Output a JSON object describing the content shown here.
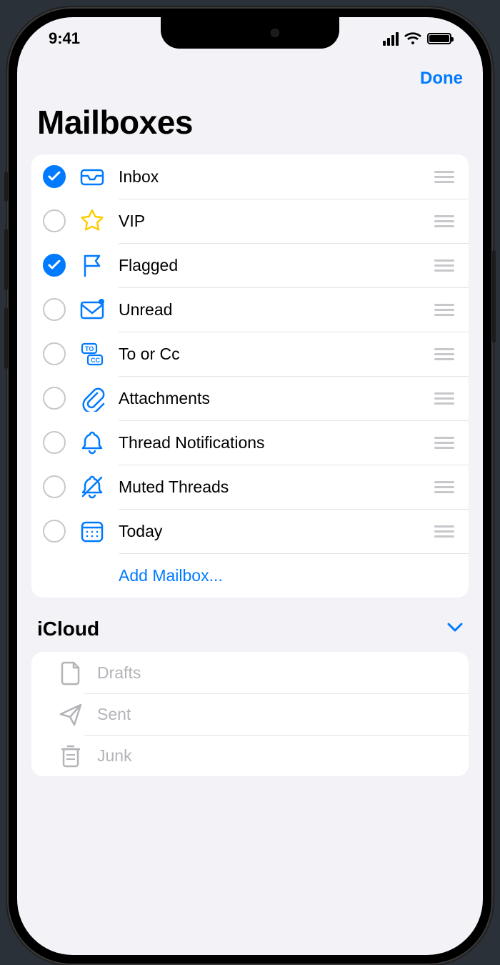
{
  "status": {
    "time": "9:41"
  },
  "nav": {
    "done_label": "Done"
  },
  "title": "Mailboxes",
  "mailboxes": [
    {
      "label": "Inbox",
      "checked": true,
      "icon": "inbox"
    },
    {
      "label": "VIP",
      "checked": false,
      "icon": "star"
    },
    {
      "label": "Flagged",
      "checked": true,
      "icon": "flag"
    },
    {
      "label": "Unread",
      "checked": false,
      "icon": "unread"
    },
    {
      "label": "To or Cc",
      "checked": false,
      "icon": "tocc"
    },
    {
      "label": "Attachments",
      "checked": false,
      "icon": "paperclip"
    },
    {
      "label": "Thread Notifications",
      "checked": false,
      "icon": "bell"
    },
    {
      "label": "Muted Threads",
      "checked": false,
      "icon": "bellslash"
    },
    {
      "label": "Today",
      "checked": false,
      "icon": "calendar"
    }
  ],
  "add_mailbox_label": "Add Mailbox...",
  "section2": {
    "title": "iCloud",
    "items": [
      {
        "label": "Drafts",
        "icon": "doc"
      },
      {
        "label": "Sent",
        "icon": "paperplane"
      },
      {
        "label": "Junk",
        "icon": "trash"
      }
    ]
  }
}
